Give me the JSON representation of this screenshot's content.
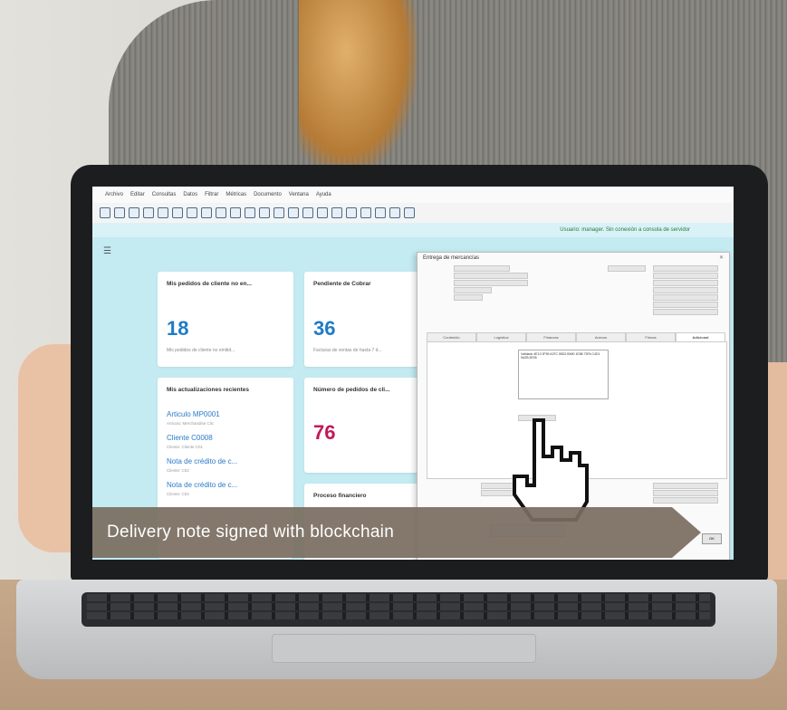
{
  "menu": [
    "Archivo",
    "Editar",
    "Consultas",
    "Datos",
    "Filtrar",
    "Métricas",
    "Documento",
    "Ventana",
    "Ayuda"
  ],
  "status_bar": {
    "text": "Usuario: manager. Sin conexión a consola de servidor"
  },
  "dashboard": {
    "tile_orders": {
      "title": "Mis pedidos de cliente no en...",
      "value": "18",
      "subtitle": "Mis pedidos de cliente no emitid..."
    },
    "tile_pending": {
      "title": "Pendiente de Cobrar",
      "value": "36",
      "subtitle": "Facturas de ventas de hasta 7 d..."
    },
    "tile_updates": {
      "title": "Mis actualizaciones recientes",
      "items": [
        {
          "label": "Articulo MP0001",
          "sub": "Articulo: Merchandise Clic"
        },
        {
          "label": "Cliente C0008",
          "sub": "Cliente: Cliente C01"
        },
        {
          "label": "Nota de crédito de c...",
          "sub": "Cliente: C02"
        },
        {
          "label": "Nota de crédito de c...",
          "sub": "Cliente: C02"
        }
      ]
    },
    "tile_order_count": {
      "title": "Número de pedidos de cli...",
      "value": "76"
    },
    "tile_finance": {
      "title": "Proceso financiero"
    }
  },
  "dialog": {
    "title": "Entrega de mercancías",
    "close_symbol": "✕",
    "tabs": [
      "Contenido",
      "Logística",
      "Finanzas",
      "Anexos",
      "Firmas",
      "Adicional"
    ],
    "tab_active": "Adicional",
    "textarea_text": "Validado 4E12 0F59 A37C 55D2 B690 1E88 73FA C4D1 9A2B 6E05",
    "accept_label": "OK"
  },
  "banner": {
    "text": "Delivery note signed with blockchain"
  }
}
